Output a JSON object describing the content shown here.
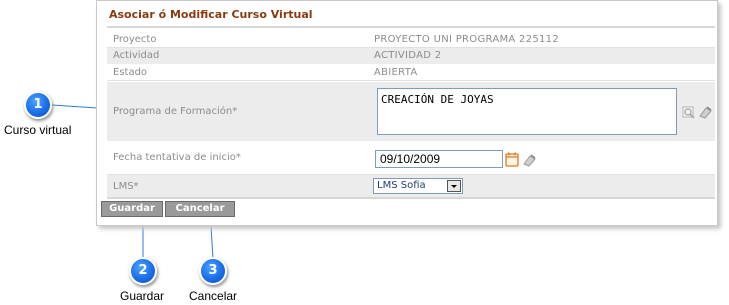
{
  "form": {
    "title": "Asociar ó Modificar Curso Virtual",
    "rows": [
      {
        "label": "Proyecto",
        "value": "PROYECTO UNI PROGRAMA 225112"
      },
      {
        "label": "Actividad",
        "value": "ACTIVIDAD 2"
      },
      {
        "label": "Estado",
        "value": "ABIERTA"
      }
    ],
    "programa": {
      "label": "Programa de Formación*",
      "value": "CREACIÓN DE JOYAS"
    },
    "fecha": {
      "label": "Fecha tentativa de inicio*",
      "value": "09/10/2009"
    },
    "lms": {
      "label": "LMS*",
      "value": "LMS Sofia"
    },
    "buttons": {
      "guardar": "Guardar",
      "cancelar": "Cancelar"
    }
  },
  "callouts": [
    {
      "number": "1",
      "label": "Curso virtual"
    },
    {
      "number": "2",
      "label": "Guardar"
    },
    {
      "number": "3",
      "label": "Cancelar"
    }
  ],
  "colors": {
    "title": "#8a3a10",
    "callout": "#1a6ee8",
    "button": "#9a9a9a"
  },
  "icons": [
    "search-icon",
    "clear-icon",
    "calendar-icon"
  ]
}
